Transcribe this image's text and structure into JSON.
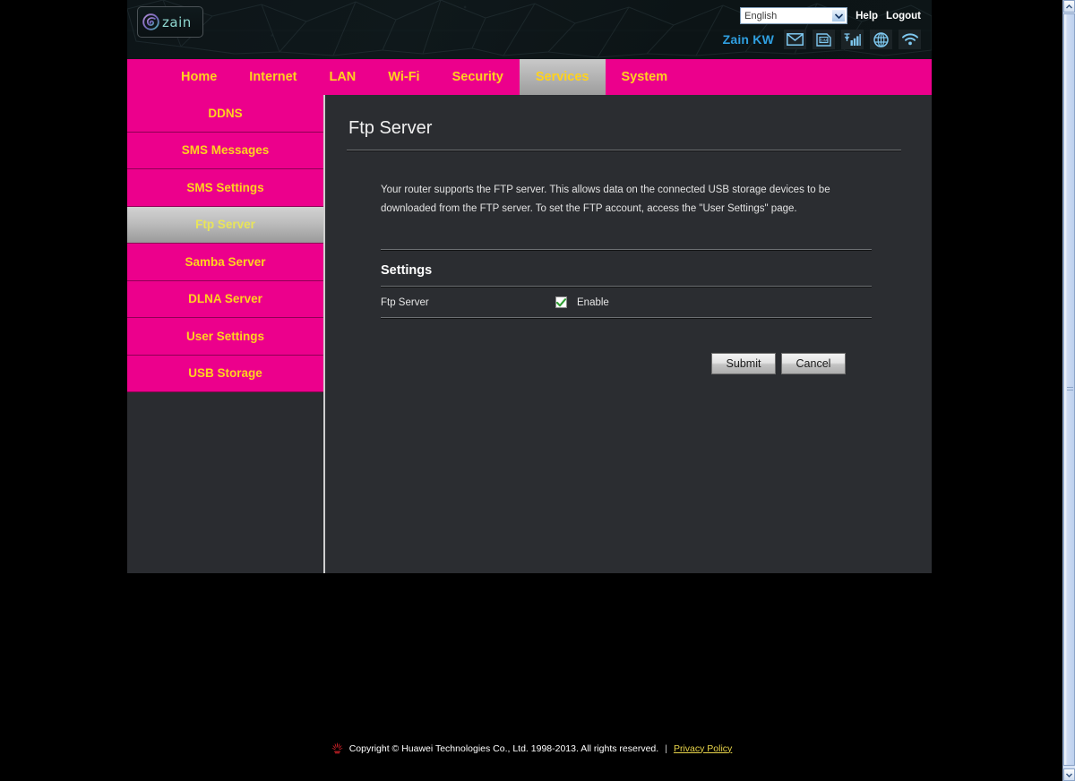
{
  "header": {
    "logo_word": "zain",
    "logo_icon": "zain-swirl-icon",
    "language": {
      "selected": "English",
      "options": [
        "English"
      ]
    },
    "help_label": "Help",
    "logout_label": "Logout",
    "carrier": "Zain KW",
    "status_icons": [
      {
        "name": "sms-envelope-icon"
      },
      {
        "name": "sim-card-icon"
      },
      {
        "name": "signal-bars-icon"
      },
      {
        "name": "internet-globe-icon"
      },
      {
        "name": "wifi-icon"
      }
    ]
  },
  "nav": {
    "items": [
      {
        "label": "Home",
        "active": false
      },
      {
        "label": "Internet",
        "active": false
      },
      {
        "label": "LAN",
        "active": false
      },
      {
        "label": "Wi-Fi",
        "active": false
      },
      {
        "label": "Security",
        "active": false
      },
      {
        "label": "Services",
        "active": true
      },
      {
        "label": "System",
        "active": false
      }
    ]
  },
  "sidebar": {
    "items": [
      {
        "label": "DDNS",
        "active": false
      },
      {
        "label": "SMS Messages",
        "active": false
      },
      {
        "label": "SMS Settings",
        "active": false
      },
      {
        "label": "Ftp Server",
        "active": true
      },
      {
        "label": "Samba Server",
        "active": false
      },
      {
        "label": "DLNA Server",
        "active": false
      },
      {
        "label": "User Settings",
        "active": false
      },
      {
        "label": "USB Storage",
        "active": false
      }
    ]
  },
  "main": {
    "title": "Ftp Server",
    "description": "Your router supports the FTP server. This allows data on the connected USB storage devices to be downloaded from the FTP server. To set the FTP account, access the \"User Settings\" page.",
    "section_title": "Settings",
    "form": {
      "ftp_server_label": "Ftp Server",
      "enable_label": "Enable",
      "enable_checked": true
    },
    "submit_label": "Submit",
    "cancel_label": "Cancel"
  },
  "footer": {
    "copyright": "Copyright © Huawei Technologies Co., Ltd. 1998-2013. All rights reserved.",
    "separator": "|",
    "privacy_label": "Privacy Policy",
    "logo_icon": "huawei-logo-icon"
  },
  "colors": {
    "brand_magenta": "#ec008c",
    "nav_text_yellow": "#ffd21e",
    "panel_dark": "#2b2d31",
    "carrier_blue": "#2f9fe0",
    "privacy_yellow": "#e8d44a",
    "checkbox_green": "#2f9e32"
  }
}
